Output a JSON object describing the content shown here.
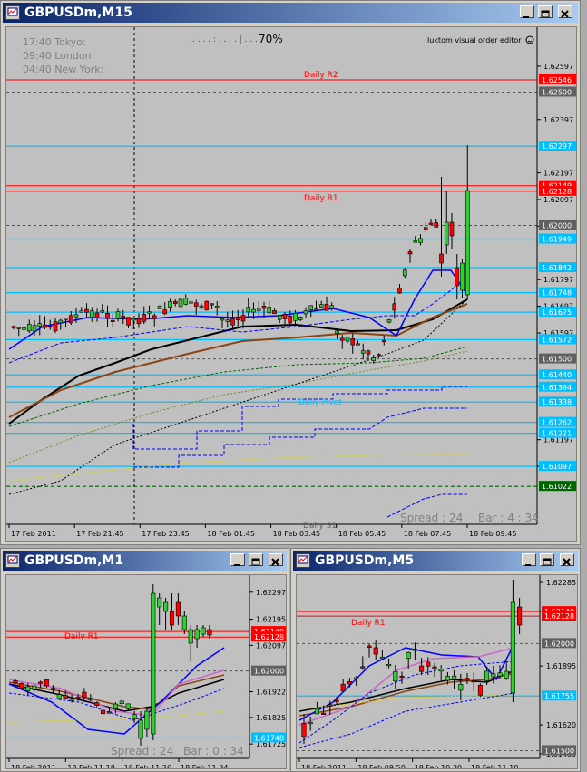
{
  "windows": {
    "m15": {
      "title": "GBPUSDm,M15",
      "clock": {
        "tokyo": "17:40 Tokyo:",
        "london": "09:40 London:",
        "newyork": "04:40 New York:"
      },
      "progress": {
        "dots": ". . . . : . . . . | . . .",
        "percent": "70%"
      },
      "indicator_label": "luktom visual order editor",
      "pivot_labels": {
        "r2": "Daily R2",
        "r1": "Daily R1",
        "pivot": "Daily Pivot",
        "s1": "Daily S1"
      },
      "price_ticks": [
        "1.62597",
        "1.62397",
        "1.62197",
        "1.62097",
        "1.61997",
        "1.61797",
        "1.61697",
        "1.61597",
        "1.61397",
        "1.61197",
        "1.61097"
      ],
      "price_tags": [
        {
          "v": "1.62546",
          "bg": "#ff0000",
          "fg": "#ffffff"
        },
        {
          "v": "1.62500",
          "bg": "#606060",
          "fg": "#ffffff"
        },
        {
          "v": "1.62297",
          "bg": "#00bfff",
          "fg": "#ffffff"
        },
        {
          "v": "1.62149",
          "bg": "#ff0000",
          "fg": "#ffffff"
        },
        {
          "v": "1.62128",
          "bg": "#ff0000",
          "fg": "#ffffff"
        },
        {
          "v": "1.62000",
          "bg": "#606060",
          "fg": "#ffffff"
        },
        {
          "v": "1.61949",
          "bg": "#00bfff",
          "fg": "#ffffff"
        },
        {
          "v": "1.61842",
          "bg": "#00bfff",
          "fg": "#ffffff"
        },
        {
          "v": "1.61748",
          "bg": "#00bfff",
          "fg": "#ffffff"
        },
        {
          "v": "1.61675",
          "bg": "#00bfff",
          "fg": "#ffffff"
        },
        {
          "v": "1.61572",
          "bg": "#00bfff",
          "fg": "#ffffff"
        },
        {
          "v": "1.61500",
          "bg": "#606060",
          "fg": "#ffffff"
        },
        {
          "v": "1.61440",
          "bg": "#00bfff",
          "fg": "#ffffff"
        },
        {
          "v": "1.61394",
          "bg": "#00bfff",
          "fg": "#ffffff"
        },
        {
          "v": "1.61338",
          "bg": "#00bfff",
          "fg": "#ffffff"
        },
        {
          "v": "1.61262",
          "bg": "#00bfff",
          "fg": "#ffffff"
        },
        {
          "v": "1.61221",
          "bg": "#00bfff",
          "fg": "#ffffff"
        },
        {
          "v": "1.61097",
          "bg": "#00bfff",
          "fg": "#ffffff"
        },
        {
          "v": "1.61022",
          "bg": "#006400",
          "fg": "#ffffff"
        }
      ],
      "time_ticks": [
        "17 Feb 2011",
        "17 Feb 21:45",
        "17 Feb 23:45",
        "18 Feb 01:45",
        "18 Feb 03:45",
        "18 Feb 05:45",
        "18 Feb 07:45",
        "18 Feb 09:45"
      ],
      "spread_text": "Spread : 24",
      "bar_text": "Bar : 4 : 34"
    },
    "m1": {
      "title": "GBPUSDm,M1",
      "pivot_labels": {
        "r1": "Daily R1"
      },
      "price_ticks": [
        "1.62297",
        "1.62195",
        "1.62097",
        "1.61922",
        "1.61825",
        "1.61725"
      ],
      "price_tags": [
        {
          "v": "1.62149",
          "bg": "#ff0000",
          "fg": "#ffffff"
        },
        {
          "v": "1.62128",
          "bg": "#ff0000",
          "fg": "#ffffff"
        },
        {
          "v": "1.62000",
          "bg": "#606060",
          "fg": "#ffffff"
        },
        {
          "v": "1.61748",
          "bg": "#00bfff",
          "fg": "#ffffff"
        }
      ],
      "time_ticks": [
        "18 Feb 2011",
        "18 Feb 11:18",
        "18 Feb 11:26",
        "18 Feb 11:34"
      ],
      "spread_text": "Spread : 24",
      "bar_text": "Bar : 0 : 34"
    },
    "m5": {
      "title": "GBPUSDm,M5",
      "pivot_labels": {
        "r1": "Daily R1"
      },
      "price_ticks": [
        "1.62285",
        "1.62150",
        "1.61895",
        "1.61620",
        "1.61485"
      ],
      "price_tags": [
        {
          "v": "1.62149",
          "bg": "#ff0000",
          "fg": "#ffffff"
        },
        {
          "v": "1.62128",
          "bg": "#ff0000",
          "fg": "#ffffff"
        },
        {
          "v": "1.62000",
          "bg": "#606060",
          "fg": "#ffffff"
        },
        {
          "v": "1.61755",
          "bg": "#00bfff",
          "fg": "#ffffff"
        },
        {
          "v": "1.61500",
          "bg": "#606060",
          "fg": "#ffffff"
        }
      ],
      "time_ticks": [
        "18 Feb 2011",
        "18 Feb 09:50",
        "18 Feb 10:30",
        "18 Feb 11:10"
      ]
    }
  },
  "colors": {
    "chart_bg": "#c0c0c0",
    "bull": "#32cd32",
    "bear": "#ff0000",
    "pivot": "#ff0000",
    "sr": "#00bfff",
    "title_from": "#0a246a",
    "title_to": "#a6caf0"
  }
}
